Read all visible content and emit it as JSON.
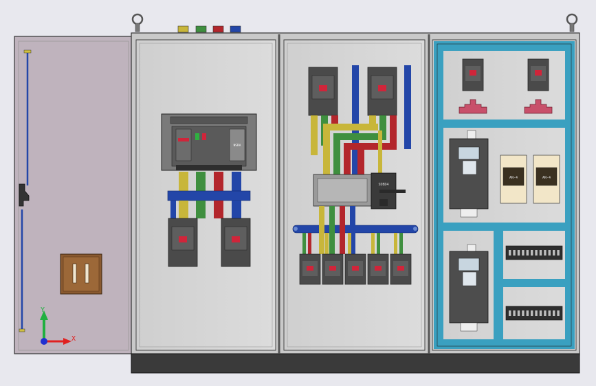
{
  "colors": {
    "background": "#e8e8ee",
    "cabinet": "#c9c9c9",
    "panel": "#d6d6d6",
    "door": "#bfb3bd",
    "plinth": "#3a3a3a",
    "bus_yellow": "#c8b63a",
    "bus_green": "#3f8f3f",
    "bus_red": "#b3262c",
    "bus_blue": "#2346a8",
    "rail_teal": "#3aa0c0",
    "breaker_body": "#4a4a4a",
    "breaker_red": "#d0253a",
    "terminal_pink": "#c8506a",
    "axis_x": "#e02020",
    "axis_y": "#20b040",
    "axis_z": "#2030d0"
  },
  "labels": {
    "acb_tag": "NSRA",
    "transfer_switch_tag": "SDBD4",
    "starter_left": "AN-4",
    "starter_right": "AN-4"
  },
  "axis": {
    "x": "X",
    "y": "Y"
  }
}
